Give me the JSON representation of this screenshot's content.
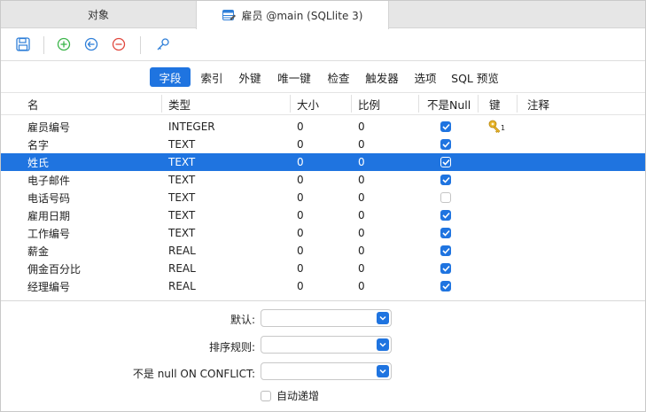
{
  "tabs": {
    "objects_label": "对象",
    "table_label": "雇员 @main (SQLlite 3)"
  },
  "toolbar": {
    "icons": [
      "save-icon",
      "add-field-icon",
      "insert-field-icon",
      "delete-field-icon",
      "primary-key-icon"
    ]
  },
  "subtabs": [
    "字段",
    "索引",
    "外键",
    "唯一键",
    "检查",
    "触发器",
    "选项",
    "SQL 预览"
  ],
  "columns": {
    "name": "名",
    "type": "类型",
    "size": "大小",
    "scale": "比例",
    "not_null": "不是Null",
    "key": "键",
    "comment": "注释"
  },
  "fields": [
    {
      "name": "雇员编号",
      "type": "INTEGER",
      "size": "0",
      "scale": "0",
      "not_null": true,
      "key": "1"
    },
    {
      "name": "名字",
      "type": "TEXT",
      "size": "0",
      "scale": "0",
      "not_null": true,
      "key": ""
    },
    {
      "name": "姓氏",
      "type": "TEXT",
      "size": "0",
      "scale": "0",
      "not_null": true,
      "key": "",
      "selected": true
    },
    {
      "name": "电子邮件",
      "type": "TEXT",
      "size": "0",
      "scale": "0",
      "not_null": true,
      "key": ""
    },
    {
      "name": "电话号码",
      "type": "TEXT",
      "size": "0",
      "scale": "0",
      "not_null": false,
      "key": ""
    },
    {
      "name": "雇用日期",
      "type": "TEXT",
      "size": "0",
      "scale": "0",
      "not_null": true,
      "key": ""
    },
    {
      "name": "工作编号",
      "type": "TEXT",
      "size": "0",
      "scale": "0",
      "not_null": true,
      "key": ""
    },
    {
      "name": "薪金",
      "type": "REAL",
      "size": "0",
      "scale": "0",
      "not_null": true,
      "key": ""
    },
    {
      "name": "佣金百分比",
      "type": "REAL",
      "size": "0",
      "scale": "0",
      "not_null": true,
      "key": ""
    },
    {
      "name": "经理编号",
      "type": "REAL",
      "size": "0",
      "scale": "0",
      "not_null": true,
      "key": ""
    }
  ],
  "form": {
    "default_label": "默认:",
    "default_value": "",
    "collation_label": "排序规则:",
    "collation_value": "",
    "not_null_conflict_label": "不是 null ON CONFLICT:",
    "not_null_conflict_value": "",
    "auto_increment_label": "自动递增",
    "auto_increment_checked": false
  },
  "colors": {
    "accent": "#1f74e0",
    "add": "#3bb54a",
    "insert": "#2f7fd8",
    "delete": "#e0463c",
    "key": "#d9a21b"
  }
}
